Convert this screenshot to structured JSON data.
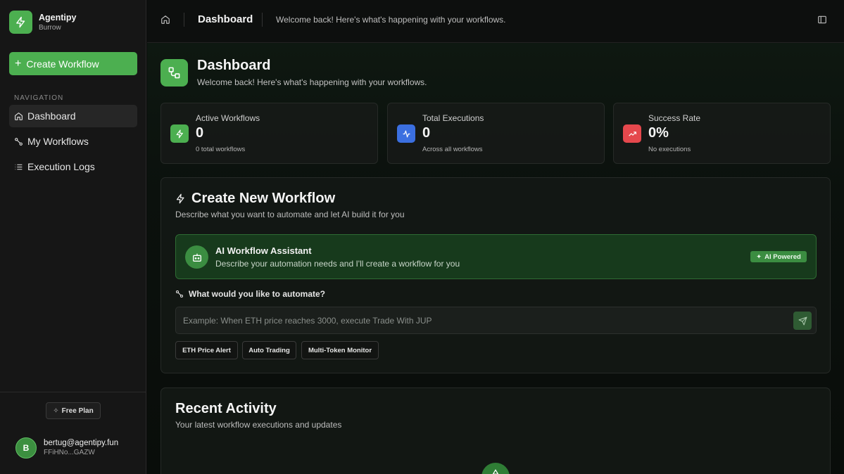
{
  "brand": {
    "name": "Agentipy",
    "subtitle": "Burrow",
    "color": "#4caf50"
  },
  "sidebar": {
    "create_button": "Create Workflow",
    "nav_heading": "NAVIGATION",
    "items": [
      {
        "label": "Dashboard",
        "icon": "home-icon",
        "active": true
      },
      {
        "label": "My Workflows",
        "icon": "workflow-icon"
      },
      {
        "label": "Execution Logs",
        "icon": "list-icon"
      }
    ],
    "plan": "Free Plan",
    "user": {
      "initial": "B",
      "email": "bertug@agentipy.fun",
      "id": "FFiHNo...GAZW"
    }
  },
  "topbar": {
    "title": "Dashboard",
    "subtitle": "Welcome back! Here's what's happening with your workflows."
  },
  "header": {
    "title": "Dashboard",
    "subtitle": "Welcome back! Here's what's happening with your workflows."
  },
  "stats": [
    {
      "label": "Active Workflows",
      "value": "0",
      "note": "0 total workflows",
      "icon": "zap-icon",
      "color": "#4caf50"
    },
    {
      "label": "Total Executions",
      "value": "0",
      "note": "Across all workflows",
      "icon": "activity-icon",
      "color": "#3b6fe0"
    },
    {
      "label": "Success Rate",
      "value": "0%",
      "note": "No executions",
      "icon": "trending-up-icon",
      "color": "#e5484d"
    }
  ],
  "create": {
    "title": "Create New Workflow",
    "subtitle": "Describe what you want to automate and let AI build it for you",
    "assistant": {
      "title": "AI Workflow Assistant",
      "subtitle": "Describe your automation needs and I'll create a workflow for you",
      "badge": "AI Powered"
    },
    "question": "What would you like to automate?",
    "placeholder": "Example: When ETH price reaches 3000, execute Trade With JUP",
    "chips": [
      "ETH Price Alert",
      "Auto Trading",
      "Multi-Token Monitor"
    ]
  },
  "activity": {
    "title": "Recent Activity",
    "subtitle": "Your latest workflow executions and updates"
  }
}
